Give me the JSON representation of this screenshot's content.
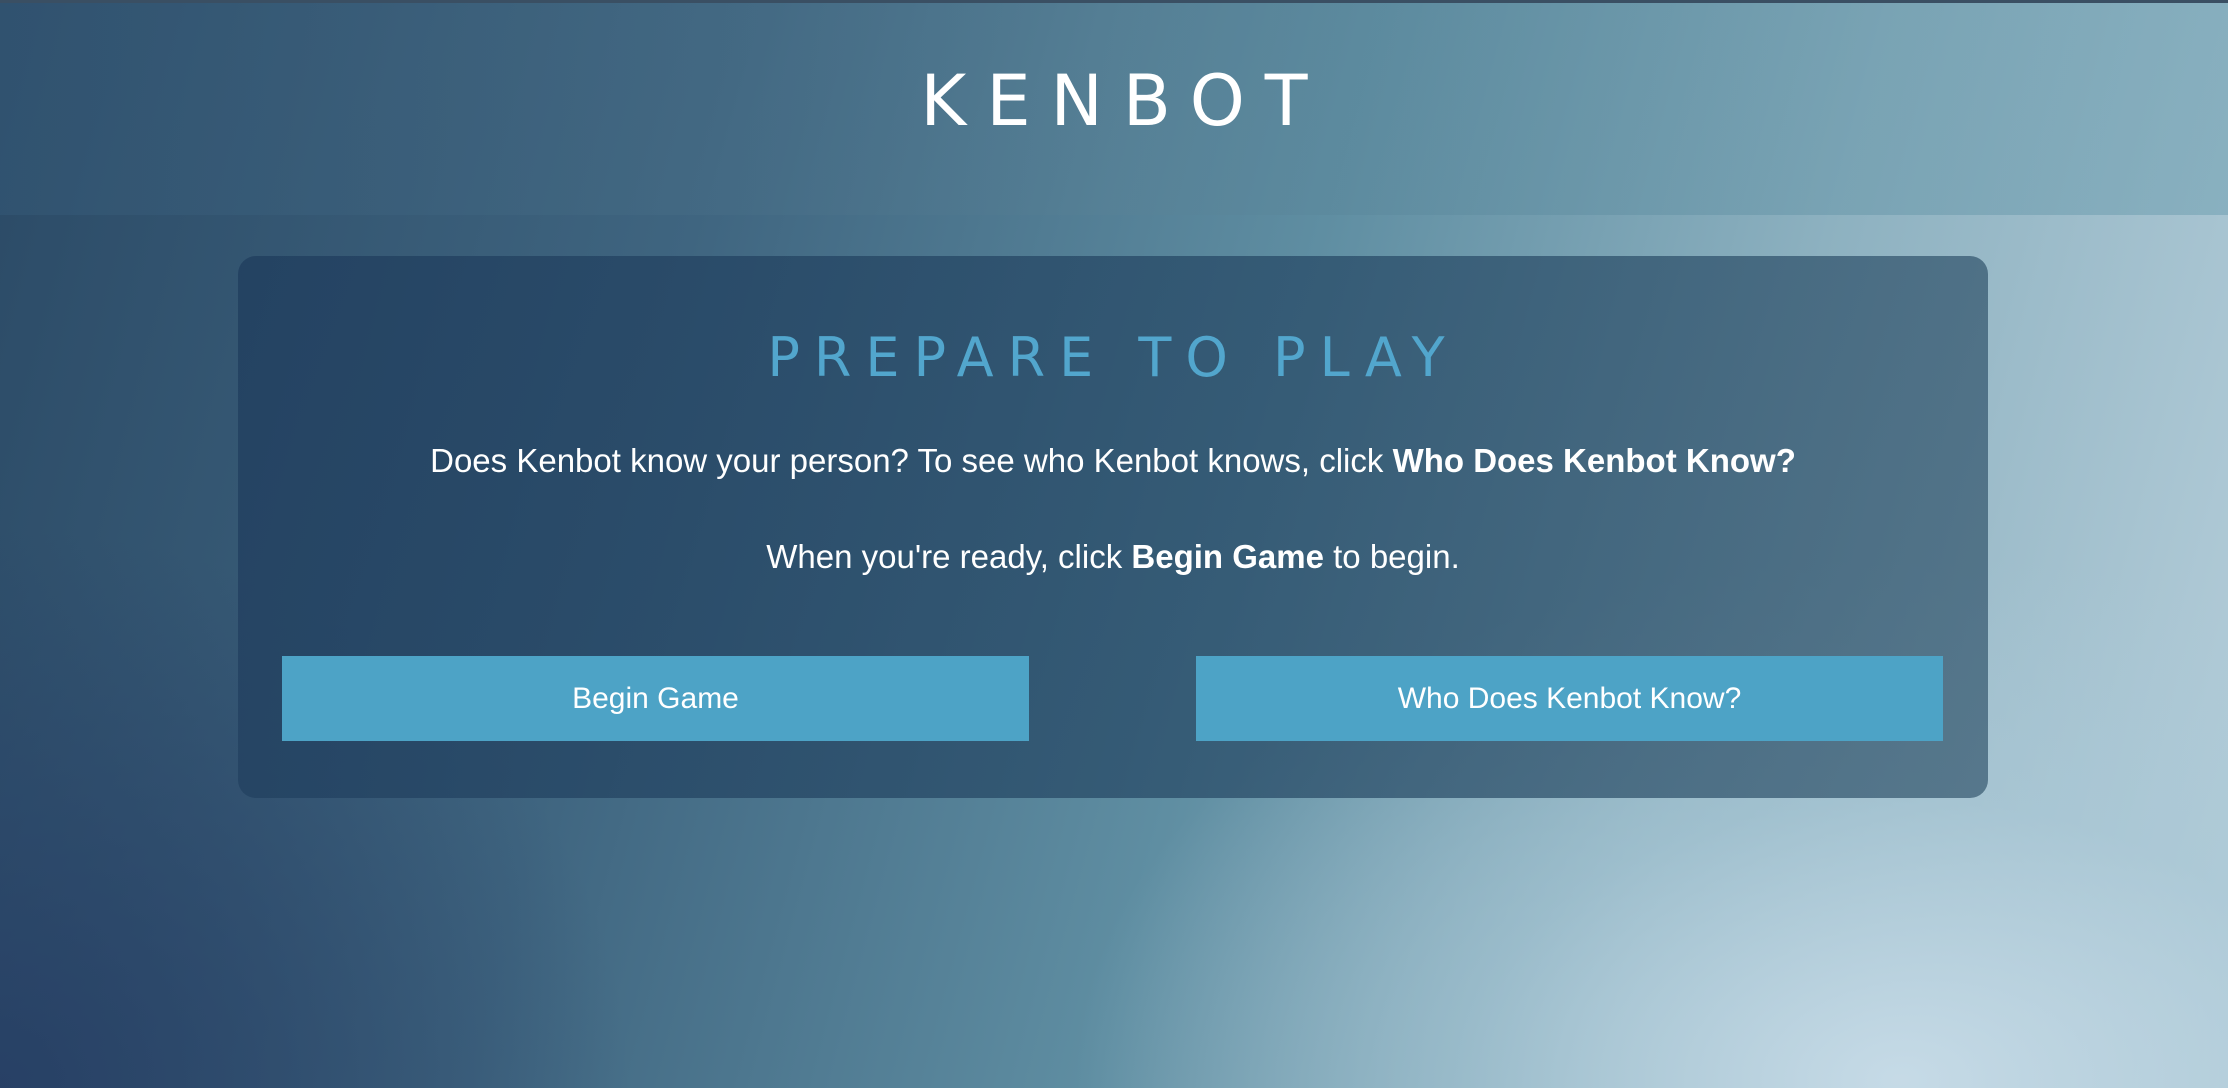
{
  "header": {
    "brand": "KENBOT"
  },
  "card": {
    "title": "PREPARE TO PLAY",
    "line1_prefix": "Does Kenbot know your person? To see who Kenbot knows, click ",
    "line1_bold": "Who Does Kenbot Know?",
    "line2_prefix": "When you're ready, click ",
    "line2_bold": "Begin Game",
    "line2_suffix": " to begin."
  },
  "buttons": {
    "begin_label": "Begin Game",
    "who_label": "Who Does Kenbot Know?"
  },
  "colors": {
    "accent": "#4da3c6",
    "title_color": "#52a6cd",
    "card_bg": "#2c5070"
  }
}
